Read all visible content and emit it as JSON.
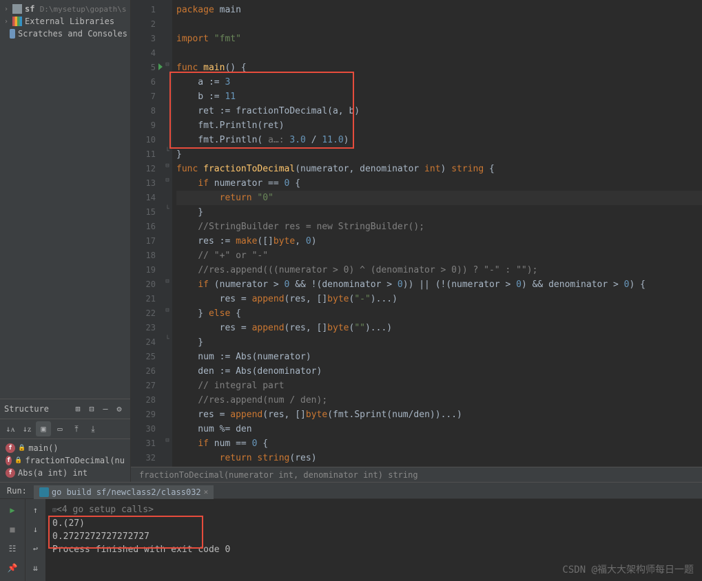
{
  "project": {
    "name": "sf",
    "path": "D:\\mysetup\\gopath\\s",
    "external_libs": "External Libraries",
    "scratches": "Scratches and Consoles"
  },
  "structure": {
    "title": "Structure",
    "items": [
      {
        "name": "main()"
      },
      {
        "name": "fractionToDecimal(nu"
      },
      {
        "name": "Abs(a int) int"
      }
    ]
  },
  "gutter_lines": [
    "1",
    "2",
    "3",
    "4",
    "5",
    "6",
    "7",
    "8",
    "9",
    "10",
    "11",
    "12",
    "13",
    "14",
    "15",
    "16",
    "17",
    "18",
    "19",
    "20",
    "21",
    "22",
    "23",
    "24",
    "25",
    "26",
    "27",
    "28",
    "29",
    "30",
    "31",
    "32"
  ],
  "breadcrumb": "fractionToDecimal(numerator int, denominator int) string",
  "run": {
    "label": "Run:",
    "tab": "go build sf/newclass2/class032",
    "setup": "<4 go setup calls>",
    "out1": "0.(27)",
    "out2": "0.2727272727272727",
    "exit": "Process finished with exit code 0"
  },
  "watermark": "CSDN @福大大架构师每日一题",
  "code": {
    "l1": "package main",
    "l3": "import \"fmt\"",
    "l5": "func main() {",
    "l6": "    a := 3",
    "l7": "    b := 11",
    "l8": "    ret := fractionToDecimal(a, b)",
    "l9": "    fmt.Println(ret)",
    "l10a": "    fmt.Println( ",
    "l10hint": "a…: ",
    "l10b": "3.0 / 11.0)",
    "l11": "}",
    "l12": "func fractionToDecimal(numerator, denominator int) string {",
    "l13": "    if numerator == 0 {",
    "l14": "        return \"0\"",
    "l15": "    }",
    "l16": "    //StringBuilder res = new StringBuilder();",
    "l17": "    res := make([]byte, 0)",
    "l18": "    // \"+\" or \"-\"",
    "l19": "    //res.append(((numerator > 0) ^ (denominator > 0)) ? \"-\" : \"\");",
    "l20": "    if (numerator > 0 && !(denominator > 0)) || (!(numerator > 0) && denominator > 0) {",
    "l21": "        res = append(res, []byte(\"-\")...)",
    "l22": "    } else {",
    "l23": "        res = append(res, []byte(\"\")...)",
    "l24": "    }",
    "l25": "    num := Abs(numerator)",
    "l26": "    den := Abs(denominator)",
    "l27": "    // integral part",
    "l28": "    //res.append(num / den);",
    "l29": "    res = append(res, []byte(fmt.Sprint(num/den))...)",
    "l30": "    num %= den",
    "l31": "    if num == 0 {",
    "l32": "        return string(res)"
  }
}
